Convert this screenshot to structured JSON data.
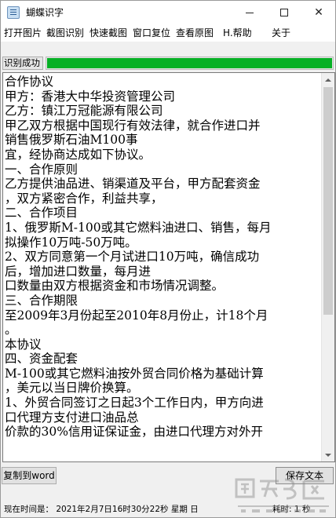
{
  "window": {
    "title": "蝴蝶识字",
    "minimize_icon": "minimize-icon",
    "maximize_icon": "maximize-icon",
    "close_icon": "close-icon"
  },
  "menu": {
    "items": [
      "打开图片",
      "截图识别",
      "快速截图",
      "窗口复位",
      "查看原图",
      "H.帮助",
      "关于"
    ]
  },
  "status": {
    "label": "识别成功",
    "progress_fraction": 1.0,
    "progress_color": "#06b025"
  },
  "document": {
    "lines": [
      "合作协议",
      "甲方：香港大中华投资管理公司",
      "乙方：镇江万冠能源有限公司",
      "甲乙双方根据中国现行有效法律，就合作进口并",
      "销售俄罗斯石油M100事",
      "宜，经协商达成如下协议。",
      "一、合作原则",
      "乙方提供油品进、销渠道及平台，甲方配套资金",
      "，双方紧密合作，利益共享，",
      "二、合作项目",
      "1、俄罗斯M-100或其它燃料油进口、销售，每月",
      "拟操作10万吨-50万吨。",
      "2、双方同意第一个月试进口10万吨，确信成功",
      "后，增加进口数量，每月进",
      "口数量由双方根据资金和市场情况调整。",
      "三、合作期限",
      "至2009年3月份起至2010年8月份止，计18个月",
      "。",
      "本协议",
      "四、资金配套",
      "M-100或其它燃料油按外贸合同价格为基础计算",
      "，美元以当日牌价换算。",
      "1、外贸合同签订之日起3个工作日内，甲方向进",
      "口代理方支付进口油品总",
      "价款的30%信用证保证金，由进口代理方对外开"
    ]
  },
  "buttons": {
    "copy_to_word": "复制到word",
    "save_text": "保存文本"
  },
  "footer": {
    "current_time": "现在时间是： 2021年2月7日16时30分22秒  星期 日",
    "elapsed": "耗时: 1 秒"
  }
}
